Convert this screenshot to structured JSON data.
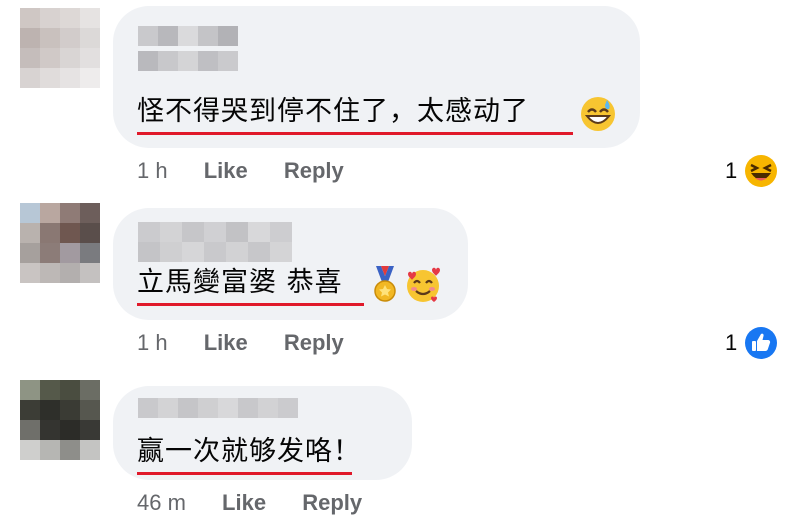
{
  "comments": [
    {
      "text": "怪不得哭到停不住了，太感动了",
      "emoji": "grinning-sweat-emoji",
      "time": "1 h",
      "like": "Like",
      "reply": "Reply",
      "reaction_count": "1",
      "reaction_icon": "laughing-reaction-icon"
    },
    {
      "text": "立馬變富婆 恭喜",
      "emoji": "medal-and-smiling-hearts-emoji",
      "time": "1 h",
      "like": "Like",
      "reply": "Reply",
      "reaction_count": "1",
      "reaction_icon": "like-reaction-icon"
    },
    {
      "text": "赢一次就够发咯！",
      "time": "46 m",
      "like": "Like",
      "reply": "Reply"
    }
  ],
  "colors": {
    "bubble": "#f0f2f5",
    "underline": "#e0192a",
    "meta": "#65676b",
    "like_blue": "#1877f2",
    "emoji_yellow": "#f7b500"
  }
}
